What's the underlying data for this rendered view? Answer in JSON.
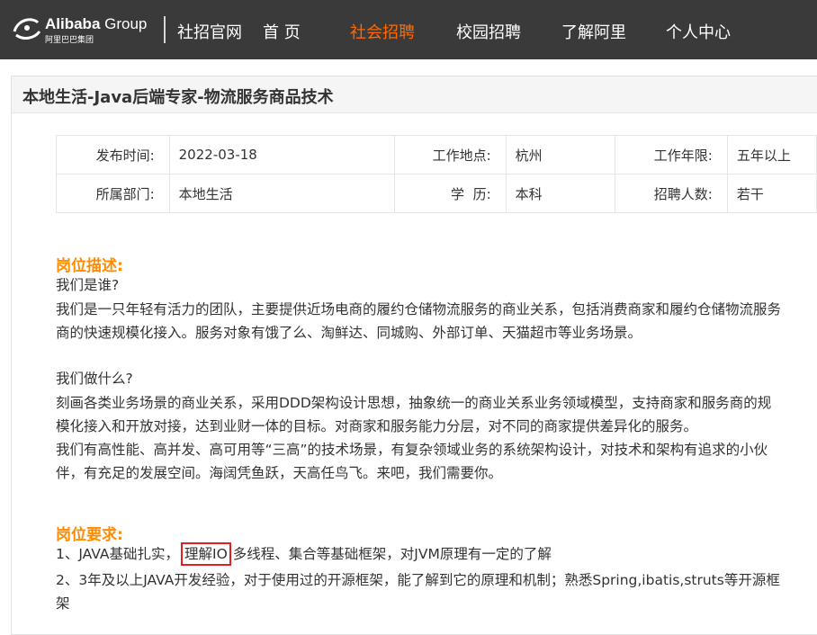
{
  "header": {
    "brand_en": "Alibaba",
    "brand_group": "Group",
    "brand_cn": "阿里巴巴集团",
    "nav": [
      "社招官网",
      "首 页",
      "社会招聘",
      "校园招聘",
      "了解阿里",
      "个人中心"
    ],
    "active_nav": "社会招聘",
    "accent_color": "#ff6a00"
  },
  "job": {
    "title": "本地生活-Java后端专家-物流服务商品技术",
    "info": {
      "publish_label": "发布时间:",
      "publish_value": "2022-03-18",
      "location_label": "工作地点:",
      "location_value": "杭州",
      "years_label": "工作年限:",
      "years_value": "五年以上",
      "dept_label": "所属部门:",
      "dept_value": "本地生活",
      "edu_label": "学  历:",
      "edu_value": "本科",
      "count_label": "招聘人数:",
      "count_value": "若干"
    },
    "description": {
      "heading": "岗位描述:",
      "lines": [
        "我们是谁?",
        "我们是一只年轻有活力的团队，主要提供近场电商的履约仓储物流服务的商业关系，包括消费商家和履约仓储物流服务",
        "商的快速规模化接入。服务对象有饿了么、淘鲜达、同城购、外部订单、天猫超市等业务场景。",
        "我们做什么?",
        "刻画各类业务场景的商业关系，采用DDD架构设计思想，抽象统一的商业关系业务领域模型，支持商家和服务商的规",
        "模化接入和开放对接，达到业财一体的目标。对商家和服务能力分层，对不同的商家提供差异化的服务。",
        "我们有高性能、高并发、高可用等“三高”的技术场景，有复杂领域业务的系统架构设计，对技术和架构有追求的小伙",
        "伴，有充足的发展空间。海阔凭鱼跃，天高任鸟飞。来吧，我们需要你。"
      ]
    },
    "requirements": {
      "heading": "岗位要求:",
      "r1_prefix": "1、JAVA基础扎实，",
      "r1_highlight": "理解IO",
      "r1_suffix": "多线程、集合等基础框架，对JVM原理有一定的了解",
      "r2_line1": "2、3年及以上JAVA开发经验，对于使用过的开源框架，能了解到它的原理和机制；熟悉Spring,ibatis,struts等开源框",
      "r2_line2": "架"
    }
  }
}
